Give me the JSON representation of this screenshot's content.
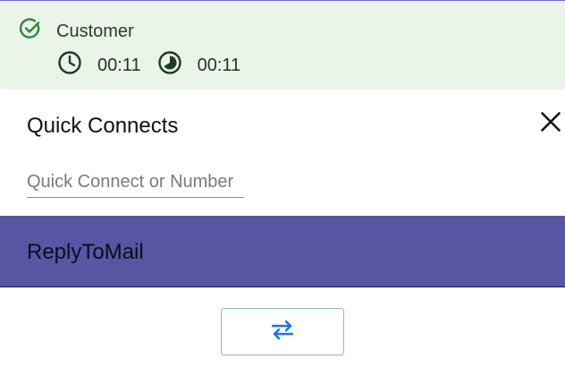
{
  "contact": {
    "status_label": "Customer",
    "status_icon": "check-circle-icon",
    "elapsed_time": "00:11",
    "elapsed_icon": "clock-icon",
    "after_time": "00:11",
    "after_icon": "pie-timer-icon",
    "panel_color": "#eaf4e9",
    "icon_color": "#2f8a3c"
  },
  "quick_connects": {
    "title": "Quick Connects",
    "close_icon": "close-icon",
    "search_placeholder": "Quick Connect or Number",
    "search_value": "",
    "items": [
      {
        "label": "ReplyToMail",
        "selected": true
      }
    ],
    "selected_color": "#5756a3"
  },
  "transfer": {
    "icon": "swap-arrows-icon",
    "icon_color": "#1a73e8"
  }
}
